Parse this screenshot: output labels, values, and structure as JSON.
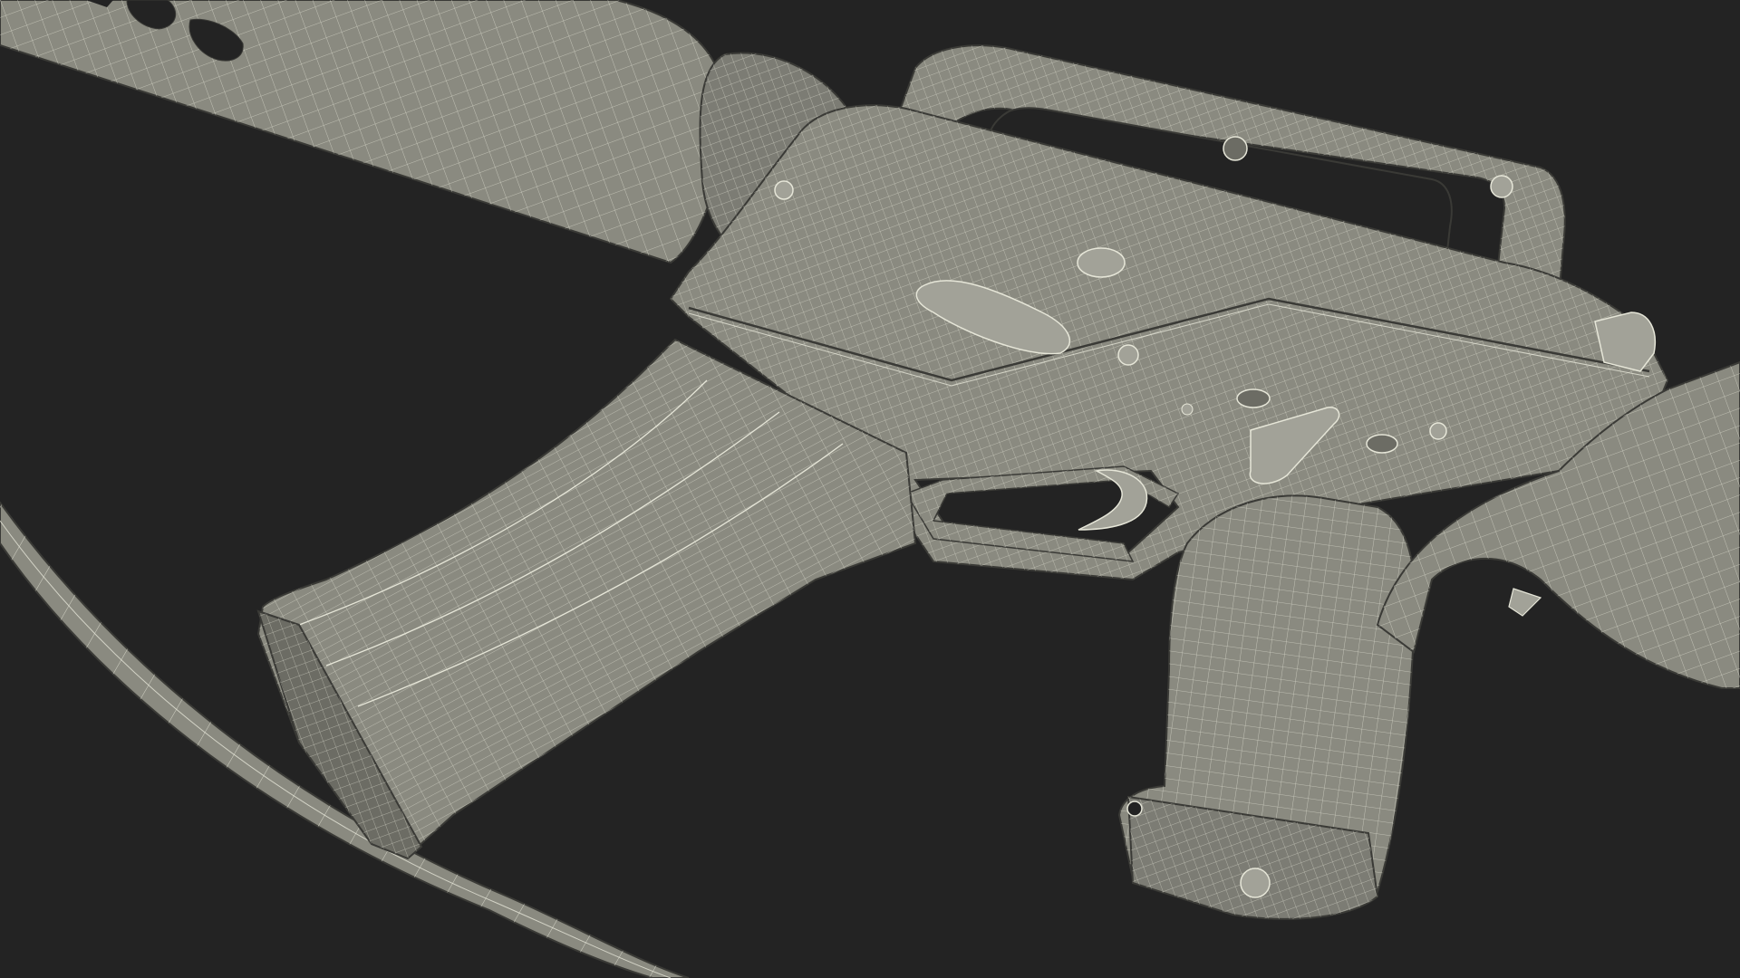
{
  "scene": {
    "subject": "wireframe-rifle-render",
    "colors": {
      "background": "#232323",
      "surface": "#8a8a80",
      "surface_dark": "#6c6c64",
      "surface_light": "#a2a298",
      "wire": "#e6e6d8",
      "outline": "#3a3a36",
      "hole": "#232323"
    }
  }
}
